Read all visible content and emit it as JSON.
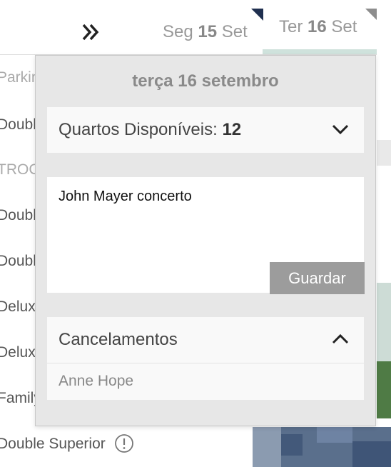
{
  "header": {
    "expand_icon": "double-chevron-right-icon",
    "days": [
      {
        "weekday": "Seg",
        "day": "15",
        "month": "Set"
      },
      {
        "weekday": "Ter",
        "day": "16",
        "month": "Set"
      }
    ]
  },
  "room_list": [
    {
      "label": "Parking",
      "type": "category"
    },
    {
      "label": "Double",
      "type": "room"
    },
    {
      "label": "TROCA",
      "type": "category"
    },
    {
      "label": "Double",
      "type": "room"
    },
    {
      "label": "Double",
      "type": "room"
    },
    {
      "label": "Deluxe",
      "type": "room"
    },
    {
      "label": "Deluxe",
      "type": "room"
    },
    {
      "label": "Family",
      "type": "room"
    },
    {
      "label": "Double Superior",
      "type": "room"
    }
  ],
  "popup": {
    "title": "terça 16 setembro",
    "availability": {
      "label": "Quartos Disponíveis:",
      "value": "12",
      "icon": "chevron-down-icon"
    },
    "note": {
      "value": "John Mayer concerto",
      "save_label": "Guardar"
    },
    "cancellations": {
      "label": "Cancelamentos",
      "icon": "chevron-up-icon",
      "items": [
        "Anne Hope"
      ]
    }
  },
  "colors": {
    "popup_bg": "#e7e7e7",
    "save_button_bg": "#9c9c9c",
    "selected_day_underline": "#cfe2dc",
    "corner_marker_dark": "#1f2f4f",
    "corner_marker_grey": "#8d8d8d"
  }
}
